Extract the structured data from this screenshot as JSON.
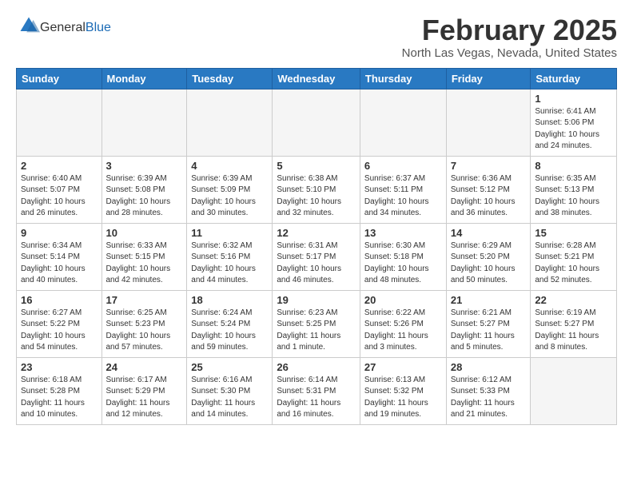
{
  "header": {
    "logo_general": "General",
    "logo_blue": "Blue",
    "main_title": "February 2025",
    "subtitle": "North Las Vegas, Nevada, United States"
  },
  "days_of_week": [
    "Sunday",
    "Monday",
    "Tuesday",
    "Wednesday",
    "Thursday",
    "Friday",
    "Saturday"
  ],
  "weeks": [
    [
      {
        "num": "",
        "info": ""
      },
      {
        "num": "",
        "info": ""
      },
      {
        "num": "",
        "info": ""
      },
      {
        "num": "",
        "info": ""
      },
      {
        "num": "",
        "info": ""
      },
      {
        "num": "",
        "info": ""
      },
      {
        "num": "1",
        "info": "Sunrise: 6:41 AM\nSunset: 5:06 PM\nDaylight: 10 hours and 24 minutes."
      }
    ],
    [
      {
        "num": "2",
        "info": "Sunrise: 6:40 AM\nSunset: 5:07 PM\nDaylight: 10 hours and 26 minutes."
      },
      {
        "num": "3",
        "info": "Sunrise: 6:39 AM\nSunset: 5:08 PM\nDaylight: 10 hours and 28 minutes."
      },
      {
        "num": "4",
        "info": "Sunrise: 6:39 AM\nSunset: 5:09 PM\nDaylight: 10 hours and 30 minutes."
      },
      {
        "num": "5",
        "info": "Sunrise: 6:38 AM\nSunset: 5:10 PM\nDaylight: 10 hours and 32 minutes."
      },
      {
        "num": "6",
        "info": "Sunrise: 6:37 AM\nSunset: 5:11 PM\nDaylight: 10 hours and 34 minutes."
      },
      {
        "num": "7",
        "info": "Sunrise: 6:36 AM\nSunset: 5:12 PM\nDaylight: 10 hours and 36 minutes."
      },
      {
        "num": "8",
        "info": "Sunrise: 6:35 AM\nSunset: 5:13 PM\nDaylight: 10 hours and 38 minutes."
      }
    ],
    [
      {
        "num": "9",
        "info": "Sunrise: 6:34 AM\nSunset: 5:14 PM\nDaylight: 10 hours and 40 minutes."
      },
      {
        "num": "10",
        "info": "Sunrise: 6:33 AM\nSunset: 5:15 PM\nDaylight: 10 hours and 42 minutes."
      },
      {
        "num": "11",
        "info": "Sunrise: 6:32 AM\nSunset: 5:16 PM\nDaylight: 10 hours and 44 minutes."
      },
      {
        "num": "12",
        "info": "Sunrise: 6:31 AM\nSunset: 5:17 PM\nDaylight: 10 hours and 46 minutes."
      },
      {
        "num": "13",
        "info": "Sunrise: 6:30 AM\nSunset: 5:18 PM\nDaylight: 10 hours and 48 minutes."
      },
      {
        "num": "14",
        "info": "Sunrise: 6:29 AM\nSunset: 5:20 PM\nDaylight: 10 hours and 50 minutes."
      },
      {
        "num": "15",
        "info": "Sunrise: 6:28 AM\nSunset: 5:21 PM\nDaylight: 10 hours and 52 minutes."
      }
    ],
    [
      {
        "num": "16",
        "info": "Sunrise: 6:27 AM\nSunset: 5:22 PM\nDaylight: 10 hours and 54 minutes."
      },
      {
        "num": "17",
        "info": "Sunrise: 6:25 AM\nSunset: 5:23 PM\nDaylight: 10 hours and 57 minutes."
      },
      {
        "num": "18",
        "info": "Sunrise: 6:24 AM\nSunset: 5:24 PM\nDaylight: 10 hours and 59 minutes."
      },
      {
        "num": "19",
        "info": "Sunrise: 6:23 AM\nSunset: 5:25 PM\nDaylight: 11 hours and 1 minute."
      },
      {
        "num": "20",
        "info": "Sunrise: 6:22 AM\nSunset: 5:26 PM\nDaylight: 11 hours and 3 minutes."
      },
      {
        "num": "21",
        "info": "Sunrise: 6:21 AM\nSunset: 5:27 PM\nDaylight: 11 hours and 5 minutes."
      },
      {
        "num": "22",
        "info": "Sunrise: 6:19 AM\nSunset: 5:27 PM\nDaylight: 11 hours and 8 minutes."
      }
    ],
    [
      {
        "num": "23",
        "info": "Sunrise: 6:18 AM\nSunset: 5:28 PM\nDaylight: 11 hours and 10 minutes."
      },
      {
        "num": "24",
        "info": "Sunrise: 6:17 AM\nSunset: 5:29 PM\nDaylight: 11 hours and 12 minutes."
      },
      {
        "num": "25",
        "info": "Sunrise: 6:16 AM\nSunset: 5:30 PM\nDaylight: 11 hours and 14 minutes."
      },
      {
        "num": "26",
        "info": "Sunrise: 6:14 AM\nSunset: 5:31 PM\nDaylight: 11 hours and 16 minutes."
      },
      {
        "num": "27",
        "info": "Sunrise: 6:13 AM\nSunset: 5:32 PM\nDaylight: 11 hours and 19 minutes."
      },
      {
        "num": "28",
        "info": "Sunrise: 6:12 AM\nSunset: 5:33 PM\nDaylight: 11 hours and 21 minutes."
      },
      {
        "num": "",
        "info": ""
      }
    ]
  ]
}
